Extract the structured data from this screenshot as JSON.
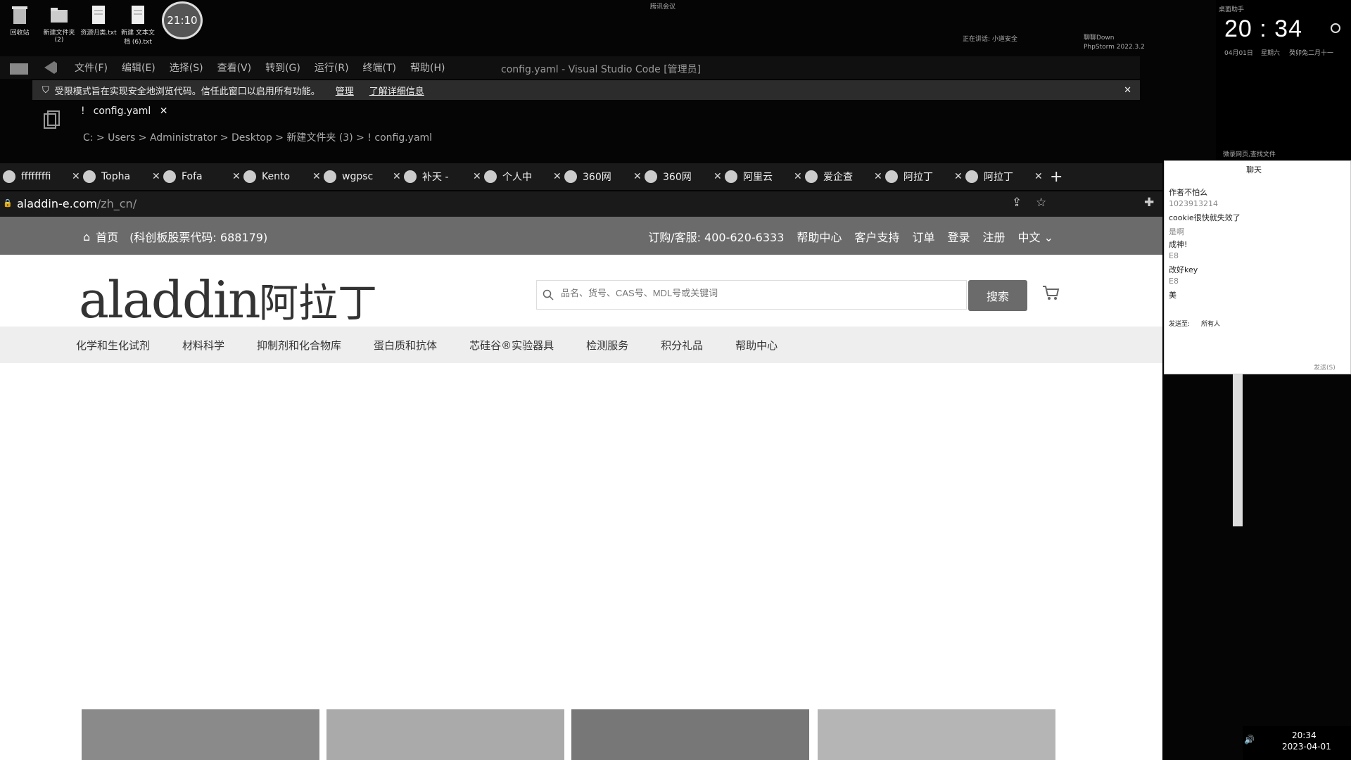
{
  "desktop": {
    "icons": [
      "回收站",
      "新建文件夹 (2)",
      "资源归类.txt",
      "新建 文本文档 (6).txt"
    ],
    "clock_badge": "21:10",
    "meeting": "腾讯会议",
    "speaking": "正在讲话: 小道安全",
    "tasks": [
      "聊聊Down",
      "PhpStorm 2022.3.2"
    ]
  },
  "widget": {
    "time": "20 : 34",
    "date": "04月01日",
    "weekday": "星期六",
    "lunar": "癸卯兔二月十一",
    "app": "桌面助手",
    "search": "微录网页,查找文件"
  },
  "vscode": {
    "menu": [
      "文件(F)",
      "编辑(E)",
      "选择(S)",
      "查看(V)",
      "转到(G)",
      "运行(R)",
      "终端(T)",
      "帮助(H)"
    ],
    "title": "config.yaml - Visual Studio Code [管理员]",
    "restricted_msg": "受限模式旨在实现安全地浏览代码。信任此窗口以启用所有功能。",
    "manage": "管理",
    "learn_more": "了解详细信息",
    "tab": "config.yaml",
    "breadcrumb": "C: > Users > Administrator > Desktop > 新建文件夹 (3) > ! config.yaml"
  },
  "browser": {
    "tabs": [
      "ffffffffi",
      "Topha",
      "Fofa",
      "Kento",
      "wgpsc",
      "补天 -",
      "个人中",
      "360网",
      "360网",
      "阿里云",
      "爱企查",
      "阿拉丁",
      "阿拉丁"
    ],
    "url_host": "aladdin-e.com",
    "url_path": "/zh_cn/"
  },
  "site": {
    "home": "首页",
    "stock": "(科创板股票代码: 688179)",
    "top_links": [
      "订购/客服: 400-620-6333",
      "帮助中心",
      "客户支持",
      "订单",
      "登录",
      "注册",
      "中文"
    ],
    "logo_en": "aladdin",
    "logo_cn": "阿拉丁",
    "search_placeholder": "品名、货号、CAS号、MDL号或关键词",
    "search_button": "搜索",
    "categories": [
      "化学和生化试剂",
      "材料科学",
      "抑制剂和化合物库",
      "蛋白质和抗体",
      "芯硅谷®实验器具",
      "检测服务",
      "积分礼品",
      "帮助中心"
    ]
  },
  "chat": {
    "title": "聊天",
    "messages": [
      "作者不怕么",
      "1023913214",
      "cookie很快就失效了",
      "是啊",
      "成神!",
      "E8",
      "改好key",
      "E8",
      "美"
    ],
    "send_to_label": "发送至:",
    "send_to_value": "所有人",
    "send": "发送(S)"
  },
  "taskbar": {
    "time": "20:34",
    "date": "2023-04-01"
  }
}
